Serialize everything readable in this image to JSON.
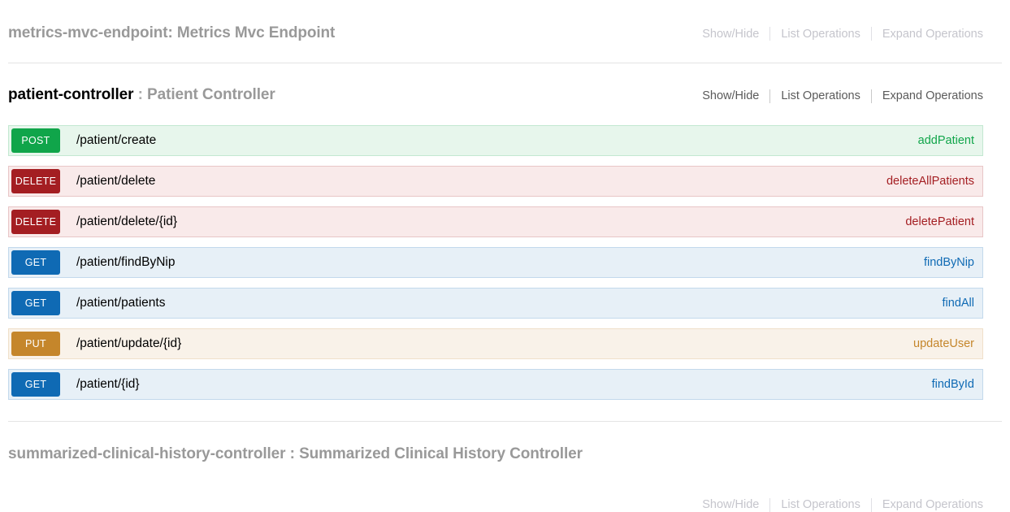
{
  "page": {
    "app": "Swagger UI",
    "options_labels": {
      "show_hide": "Show/Hide",
      "list_operations": "List Operations",
      "expand_operations": "Expand Operations"
    }
  },
  "colors": {
    "post": "#10a54a",
    "delete": "#a41e22",
    "get": "#0f6ab4",
    "put": "#c5862b",
    "muted_text": "#999999",
    "link_inactive": "#c5c5cc",
    "link_active": "#5a5a5a",
    "divider": "#e4e4e4"
  },
  "resources": [
    {
      "id": "metrics-mvc-endpoint",
      "name": "metrics-mvc-endpoint",
      "separator": ":",
      "description": "Metrics Mvc Endpoint",
      "active": false,
      "options": {
        "show_hide": "Show/Hide",
        "list_operations": "List Operations",
        "expand_operations": "Expand Operations"
      },
      "operations": []
    },
    {
      "id": "patient-controller",
      "name": "patient-controller",
      "separator": ":",
      "description": "Patient Controller",
      "active": true,
      "options": {
        "show_hide": "Show/Hide",
        "list_operations": "List Operations",
        "expand_operations": "Expand Operations"
      },
      "operations": [
        {
          "method": "POST",
          "path": "/patient/create",
          "nickname": "addPatient"
        },
        {
          "method": "DELETE",
          "path": "/patient/delete",
          "nickname": "deleteAllPatients"
        },
        {
          "method": "DELETE",
          "path": "/patient/delete/{id}",
          "nickname": "deletePatient"
        },
        {
          "method": "GET",
          "path": "/patient/findByNip",
          "nickname": "findByNip"
        },
        {
          "method": "GET",
          "path": "/patient/patients",
          "nickname": "findAll"
        },
        {
          "method": "PUT",
          "path": "/patient/update/{id}",
          "nickname": "updateUser"
        },
        {
          "method": "GET",
          "path": "/patient/{id}",
          "nickname": "findById"
        }
      ]
    },
    {
      "id": "summarized-clinical-history-controller",
      "name": "summarized-clinical-history-controller",
      "separator": ":",
      "description": "Summarized Clinical History Controller",
      "active": false,
      "options": {
        "show_hide": "Show/Hide",
        "list_operations": "List Operations",
        "expand_operations": "Expand Operations"
      },
      "operations": []
    }
  ]
}
